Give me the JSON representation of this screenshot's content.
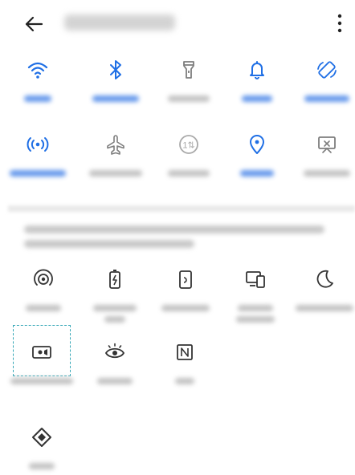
{
  "header": {
    "back_icon": "arrow-left-icon",
    "title": "",
    "more_icon": "more-vertical-icon"
  },
  "toggles_row1": [
    {
      "name": "wifi-icon",
      "label": "",
      "active": true
    },
    {
      "name": "bluetooth-icon",
      "label": "",
      "active": true
    },
    {
      "name": "flashlight-icon",
      "label": "",
      "active": false
    },
    {
      "name": "bell-icon",
      "label": "",
      "active": true
    },
    {
      "name": "rotate-icon",
      "label": "",
      "active": true
    }
  ],
  "toggles_row2": [
    {
      "name": "hotspot-icon",
      "label": "",
      "active": true
    },
    {
      "name": "airplane-icon",
      "label": "",
      "active": false
    },
    {
      "name": "dual-sim-icon",
      "label": "",
      "active": false
    },
    {
      "name": "location-icon",
      "label": "",
      "active": true
    },
    {
      "name": "screenshot-icon",
      "label": "",
      "active": false
    }
  ],
  "drag_hint": "",
  "extra_row1": [
    {
      "name": "portable-hotspot-icon",
      "label": ""
    },
    {
      "name": "battery-saver-icon",
      "label": ""
    },
    {
      "name": "projection-icon",
      "label": ""
    },
    {
      "name": "multi-screen-icon",
      "label": ""
    },
    {
      "name": "moon-icon",
      "label": ""
    }
  ],
  "extra_row2": [
    {
      "name": "screen-recorder-icon",
      "label": ""
    },
    {
      "name": "eye-comfort-icon",
      "label": ""
    },
    {
      "name": "nfc-icon",
      "label": ""
    }
  ],
  "extra_row3": [
    {
      "name": "diamond-icon",
      "label": ""
    }
  ],
  "colors": {
    "active_blue": "#1f6fe5",
    "inactive_gray": "#7d7d7d",
    "dark_icon": "#333333",
    "dashed_highlight": "#37a8b7"
  }
}
